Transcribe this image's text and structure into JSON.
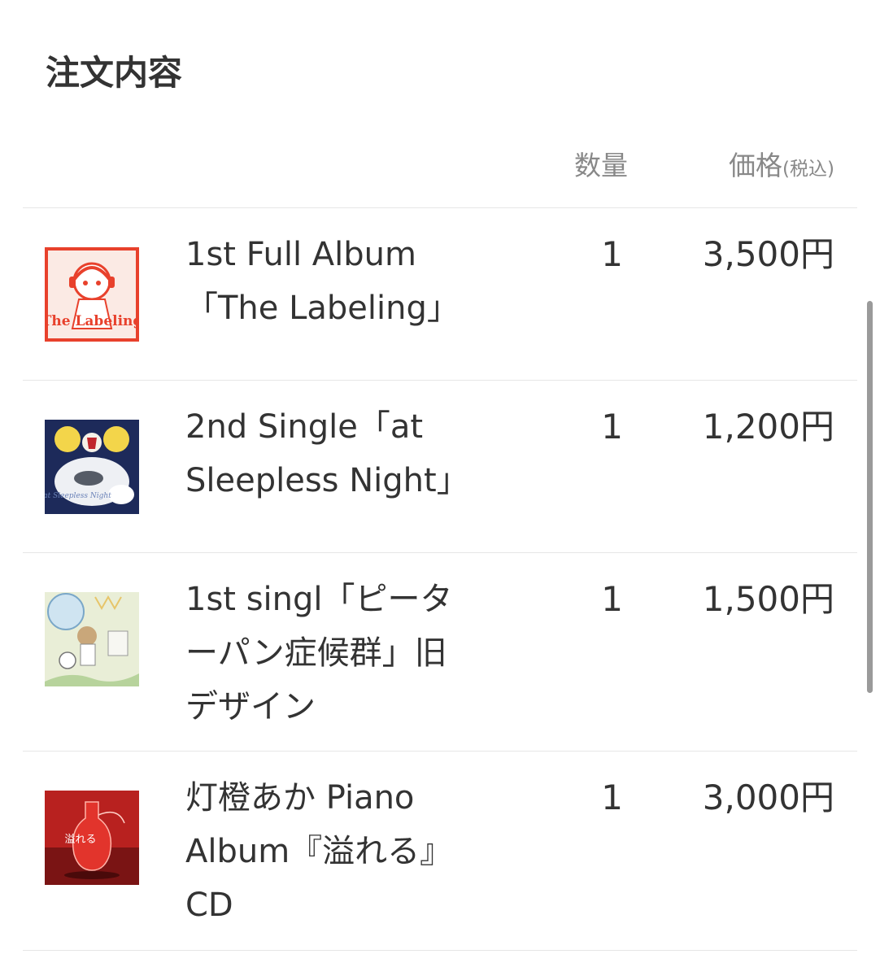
{
  "section": {
    "title": "注文内容"
  },
  "columns": {
    "quantity": "数量",
    "price": "価格",
    "price_note": "(税込)"
  },
  "items": [
    {
      "name_lines": [
        "1st Full Album",
        "「The Labeling」"
      ],
      "quantity": "1",
      "price": "3,500円",
      "cover_text": "The Labeling",
      "cover_accent": "#e8412c"
    },
    {
      "name_lines": [
        "2nd Single「at",
        "Sleepless Night」"
      ],
      "quantity": "1",
      "price": "1,200円",
      "cover_text": "at Sleepless Night",
      "cover_accent": "#1d2a5a"
    },
    {
      "name_lines": [
        "1st singl「ピータ",
        "ーパン症候群」旧",
        "デザイン"
      ],
      "quantity": "1",
      "price": "1,500円",
      "cover_accent": "#e9eed7"
    },
    {
      "name_lines": [
        "灯橙あか Piano",
        "Album『溢れる』",
        "CD"
      ],
      "quantity": "1",
      "price": "3,000円",
      "cover_text": "溢れる",
      "cover_accent": "#b8211f"
    }
  ],
  "colors": {
    "text": "#333333",
    "muted": "#888888",
    "divider": "#e6e6e6"
  }
}
